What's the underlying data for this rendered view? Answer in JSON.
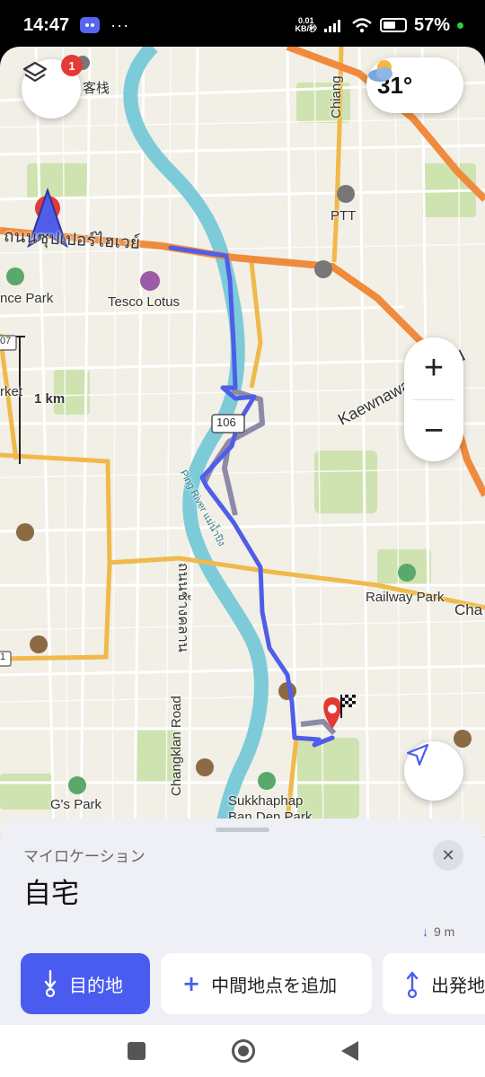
{
  "status": {
    "time": "14:47",
    "net_speed_value": "0.01",
    "net_speed_unit": "KB/秒",
    "battery": "57%",
    "battery_level": 0.57
  },
  "map": {
    "layers_badge": "1",
    "weather_temp": "31°",
    "scale_label": "1 km",
    "labels": {
      "kezhan": "客栈",
      "chiang": "Chiang",
      "ptt": "PTT",
      "thai_road": "ถนนซุปเปอร์ไฮเวย์",
      "park_left": "nce Park",
      "tesco": "Tesco Lotus",
      "road_07": "07",
      "road_1": "1",
      "rket": "rket",
      "kaewnawarat": "Kaewnawarat Road",
      "road_106": "106",
      "ping_river": "Ping River  แม่น้ำปิง",
      "thai_road2": "ถนนช้างคลาน",
      "changklan": "Changklan Road",
      "railway_park": "Railway Park",
      "cha": "Cha",
      "gs_park": "G's Park",
      "sukkhaphap": "Sukkhaphap",
      "ban_den": "Ban Den Park"
    },
    "zoom_in": "+",
    "zoom_out": "−"
  },
  "sheet": {
    "subtitle": "マイロケーション",
    "title": "自宅",
    "close": "✕",
    "elevation": "9 m",
    "actions": {
      "destination": "目的地",
      "add_waypoint": "中間地点を追加",
      "start": "出発地"
    }
  },
  "colors": {
    "route": "#4f5de8",
    "route_alt": "#8d8aa8",
    "accent": "#4a5cf0",
    "major_road": "#f08a3c",
    "secondary_road": "#f0b94a",
    "river": "#7dcbd9",
    "park": "#cfe3b0"
  }
}
